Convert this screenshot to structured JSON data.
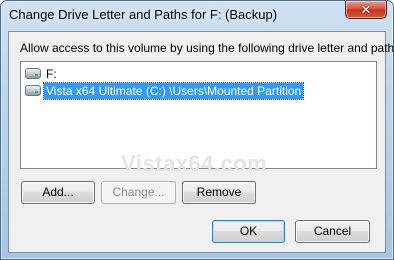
{
  "window": {
    "title": "Change Drive Letter and Paths for F: (Backup)",
    "close_label": "✕"
  },
  "dialog": {
    "instruction": "Allow access to this volume by using the following drive letter and paths:",
    "paths": [
      {
        "label": "F:",
        "icon": "drive-icon",
        "selected": false
      },
      {
        "label": "Vista x64 Ultimate (C:) \\Users\\Mounted Partition",
        "icon": "drive-icon",
        "selected": true
      }
    ],
    "watermark": "Vistax64.com"
  },
  "buttons": {
    "add": "Add...",
    "change": "Change...",
    "remove": "Remove",
    "ok": "OK",
    "cancel": "Cancel"
  },
  "colors": {
    "selection": "#3399ff",
    "titlebar": "#bcd3ea",
    "close": "#c2341e"
  }
}
